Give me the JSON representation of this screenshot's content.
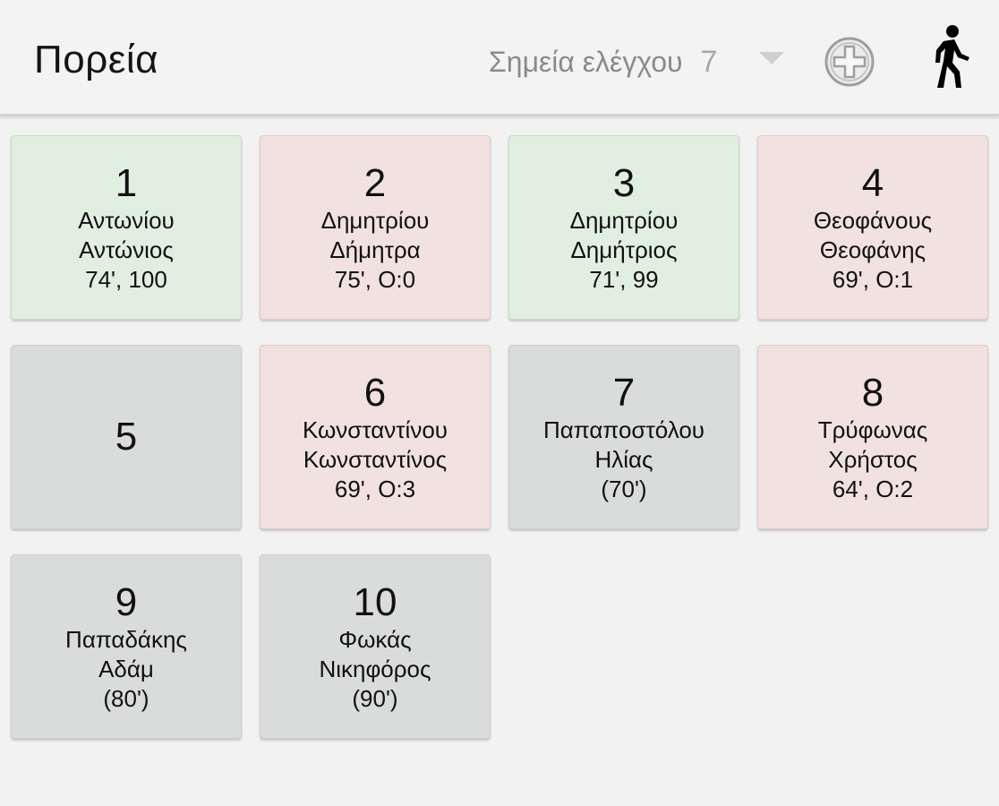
{
  "header": {
    "title": "Πορεία",
    "checkpoints_label": "Σημεία ελέγχου",
    "checkpoints_count": "7",
    "add_icon": "add-circle-icon",
    "walk_icon": "walking-person-icon"
  },
  "colors": {
    "green": "#e1efe0",
    "red": "#f2e1e1",
    "grey": "#dadbdb"
  },
  "tiles": [
    {
      "number": "1",
      "status": "green",
      "surname": "Αντωνίου",
      "name": "Αντώνιος",
      "info": "74', 100"
    },
    {
      "number": "2",
      "status": "red",
      "surname": "Δημητρίου",
      "name": "Δήμητρα",
      "info": "75', Ο:0"
    },
    {
      "number": "3",
      "status": "green",
      "surname": "Δημητρίου",
      "name": "Δημήτριος",
      "info": "71', 99"
    },
    {
      "number": "4",
      "status": "red",
      "surname": "Θεοφάνους",
      "name": "Θεοφάνης",
      "info": "69', Ο:1"
    },
    {
      "number": "5",
      "status": "grey",
      "surname": "",
      "name": "",
      "info": ""
    },
    {
      "number": "6",
      "status": "red",
      "surname": "Κωνσταντίνου",
      "name": "Κωνσταντίνος",
      "info": "69', Ο:3"
    },
    {
      "number": "7",
      "status": "grey",
      "surname": "Παπαποστόλου",
      "name": "Ηλίας",
      "info": "(70')"
    },
    {
      "number": "8",
      "status": "red",
      "surname": "Τρύφωνας",
      "name": "Χρήστος",
      "info": "64', Ο:2"
    },
    {
      "number": "9",
      "status": "grey",
      "surname": "Παπαδάκης",
      "name": "Αδάμ",
      "info": "(80')"
    },
    {
      "number": "10",
      "status": "grey",
      "surname": "Φωκάς",
      "name": "Νικηφόρος",
      "info": "(90')"
    }
  ]
}
